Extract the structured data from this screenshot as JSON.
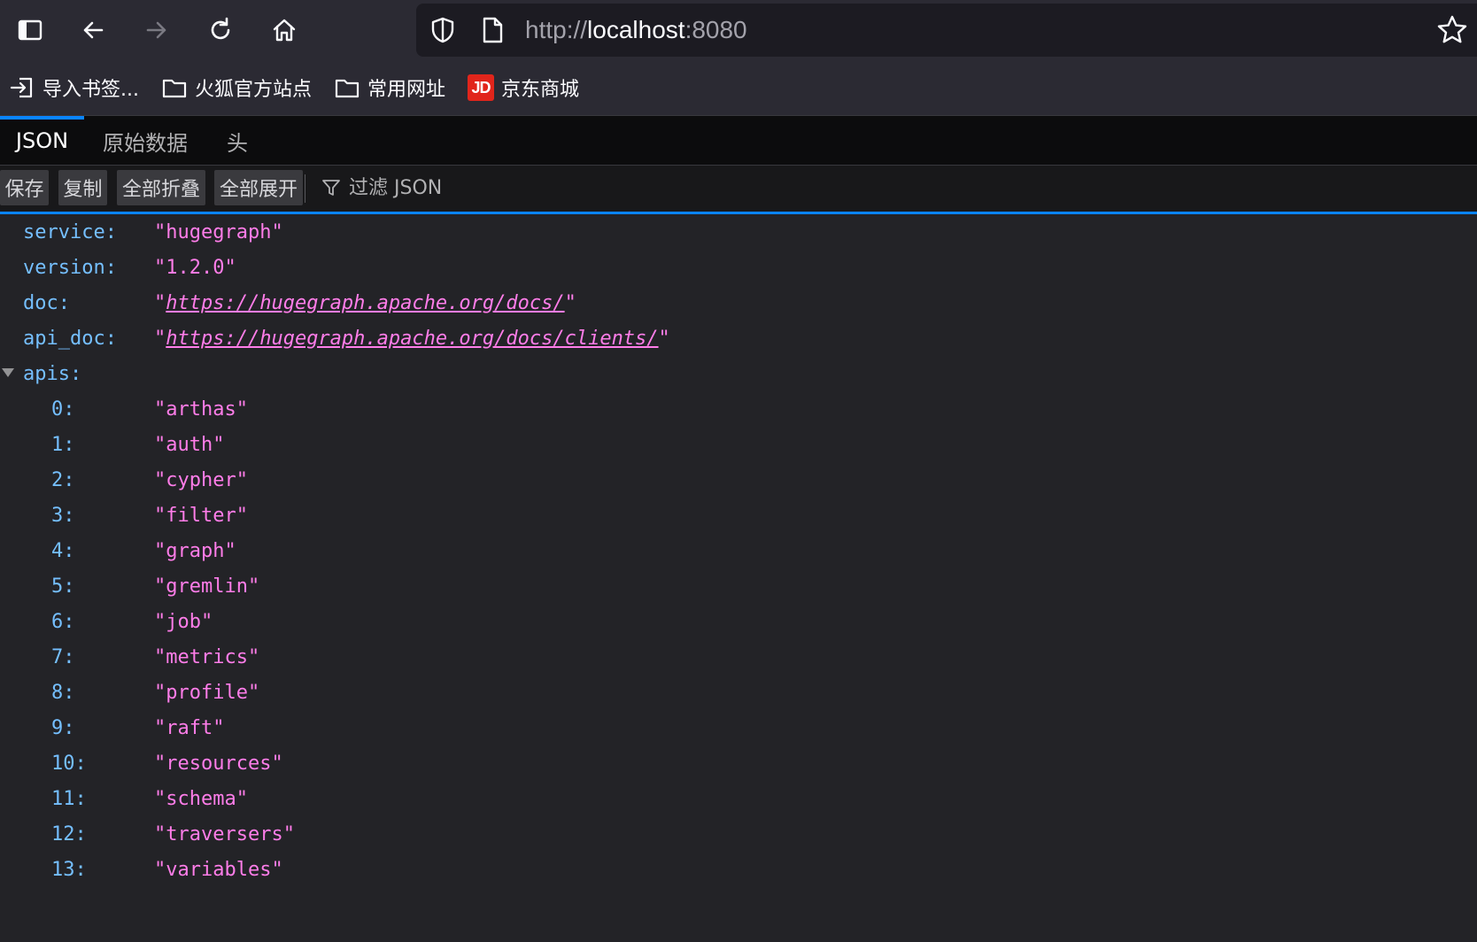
{
  "navbar": {
    "url_scheme": "http://",
    "url_host": "localhost",
    "url_port": ":8080"
  },
  "bookmarks": [
    {
      "label": "导入书签...",
      "icon": "import-icon"
    },
    {
      "label": "火狐官方站点",
      "icon": "folder-icon"
    },
    {
      "label": "常用网址",
      "icon": "folder-icon"
    },
    {
      "label": "京东商城",
      "icon": "jd-logo",
      "logo_text": "JD"
    }
  ],
  "tabs": [
    {
      "label": "JSON",
      "selected": true
    },
    {
      "label": "原始数据",
      "selected": false
    },
    {
      "label": "头",
      "selected": false
    }
  ],
  "toolbar": {
    "save": "保存",
    "copy": "复制",
    "collapse_all": "全部折叠",
    "expand_all": "全部展开",
    "filter_placeholder": "过滤 JSON"
  },
  "json": {
    "fields": [
      {
        "key": "service:",
        "value": "\"hugegraph\""
      },
      {
        "key": "version:",
        "value": "\"1.2.0\""
      },
      {
        "key": "doc:",
        "link": "https://hugegraph.apache.org/docs/"
      },
      {
        "key": "api_doc:",
        "link": "https://hugegraph.apache.org/docs/clients/"
      }
    ],
    "apis_key": "apis:",
    "apis": [
      {
        "key": "0:",
        "value": "\"arthas\""
      },
      {
        "key": "1:",
        "value": "\"auth\""
      },
      {
        "key": "2:",
        "value": "\"cypher\""
      },
      {
        "key": "3:",
        "value": "\"filter\""
      },
      {
        "key": "4:",
        "value": "\"graph\""
      },
      {
        "key": "5:",
        "value": "\"gremlin\""
      },
      {
        "key": "6:",
        "value": "\"job\""
      },
      {
        "key": "7:",
        "value": "\"metrics\""
      },
      {
        "key": "8:",
        "value": "\"profile\""
      },
      {
        "key": "9:",
        "value": "\"raft\""
      },
      {
        "key": "10:",
        "value": "\"resources\""
      },
      {
        "key": "11:",
        "value": "\"schema\""
      },
      {
        "key": "12:",
        "value": "\"traversers\""
      },
      {
        "key": "13:",
        "value": "\"variables\""
      }
    ]
  },
  "colors": {
    "key": "#75bfff",
    "string": "#ff7de9",
    "accent": "#0a84ff"
  }
}
